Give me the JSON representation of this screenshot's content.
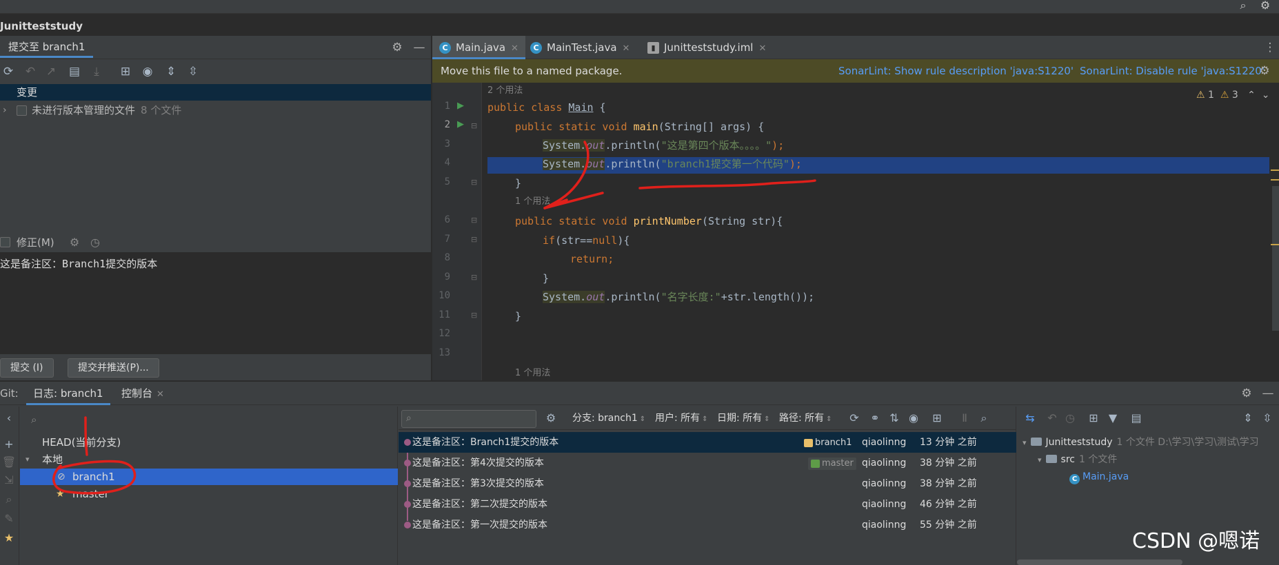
{
  "project": {
    "title": "Junitteststudy"
  },
  "commit_panel": {
    "tab_label": "提交至 branch1",
    "changes_header": "变更",
    "unversioned": {
      "label": "未进行版本管理的文件",
      "count": "8 个文件"
    },
    "amend_label": "修正(M)",
    "message": "这是备注区：Branch1提交的版本",
    "commit_button": "提交 (I)",
    "commit_push_button": "提交并推送(P)..."
  },
  "editor": {
    "tabs": [
      {
        "label": "Main.java",
        "icon": "java-class-icon"
      },
      {
        "label": "MainTest.java",
        "icon": "java-class-icon"
      },
      {
        "label": "Junitteststudy.iml",
        "icon": "file-icon"
      }
    ],
    "sonar": {
      "message": "Move this file to a named package.",
      "link1": "SonarLint: Show rule description 'java:S1220'",
      "link2": "SonarLint: Disable rule 'java:S1220'"
    },
    "warnings": {
      "weak": "1",
      "warn": "3"
    },
    "hints": {
      "usage2": "2 个用法",
      "usage1": "1 个用法",
      "usage1b": "1 个用法"
    },
    "line_numbers": [
      "1",
      "2",
      "3",
      "4",
      "5",
      "6",
      "7",
      "8",
      "9",
      "10",
      "11",
      "12",
      "13"
    ],
    "code": {
      "l1_kw": "public class ",
      "l1_cls": "Main",
      "l1_rest": " {",
      "l2_kw": "public static void ",
      "l2_fn": "main",
      "l2_rest": "(String[] args) {",
      "l3_sys": "System.",
      "l3_out": "out",
      "l3_mid": ".println(",
      "l3_str": "\"这是第四个版本。。。。\"",
      "l3_end": ");",
      "l4_sys": "System.",
      "l4_out": "out",
      "l4_mid": ".println(",
      "l4_str": "\"branch1提交第一个代码\"",
      "l4_end": ");",
      "l5": "}",
      "l6_kw": "public static void ",
      "l6_fn": "printNumber",
      "l6_rest": "(String str){",
      "l7_kw": "if",
      "l7_mid": "(str==",
      "l7_null": "null",
      "l7_end": "){",
      "l8_kw": "return",
      "l8_end": ";",
      "l9": "}",
      "l10_sys": "System.",
      "l10_out": "out",
      "l10_mid": ".println(",
      "l10_str": "\"名字长度:\"",
      "l10_end": "+str.length());",
      "l11": "}"
    }
  },
  "git": {
    "label": "Git:",
    "tabs": [
      {
        "label": "日志: branch1"
      },
      {
        "label": "控制台"
      }
    ],
    "branches": {
      "head": "HEAD(当前分支)",
      "local": "本地",
      "items": [
        "branch1",
        "master"
      ]
    },
    "filters": {
      "branch": "分支: branch1",
      "user": "用户: 所有",
      "date": "日期: 所有",
      "path": "路径: 所有"
    },
    "commits": [
      {
        "message": "这是备注区：Branch1提交的版本",
        "ref": "branch1",
        "author": "qiaolinng",
        "time": "13 分钟 之前"
      },
      {
        "message": "这是备注区：第4次提交的版本",
        "ref": "master",
        "author": "qiaolinng",
        "time": "38 分钟 之前"
      },
      {
        "message": "这是备注区：第3次提交的版本",
        "ref": "",
        "author": "qiaolinng",
        "time": "38 分钟 之前"
      },
      {
        "message": "这是备注区：第二次提交的版本",
        "ref": "",
        "author": "qiaolinng",
        "time": "46 分钟 之前"
      },
      {
        "message": "这是备注区：第一次提交的版本",
        "ref": "",
        "author": "qiaolinng",
        "time": "55 分钟 之前"
      }
    ],
    "changes_tree": {
      "root": "Junitteststudy",
      "root_meta": "1 个文件  D:\\学习\\学习\\测试\\学习",
      "src": "src",
      "src_meta": "1 个文件",
      "file": "Main.java"
    }
  },
  "watermark": "CSDN @嗯诺",
  "colors": {
    "accent": "#4a88c7",
    "selection": "#2f65ca",
    "annotation": "#e0201b"
  }
}
